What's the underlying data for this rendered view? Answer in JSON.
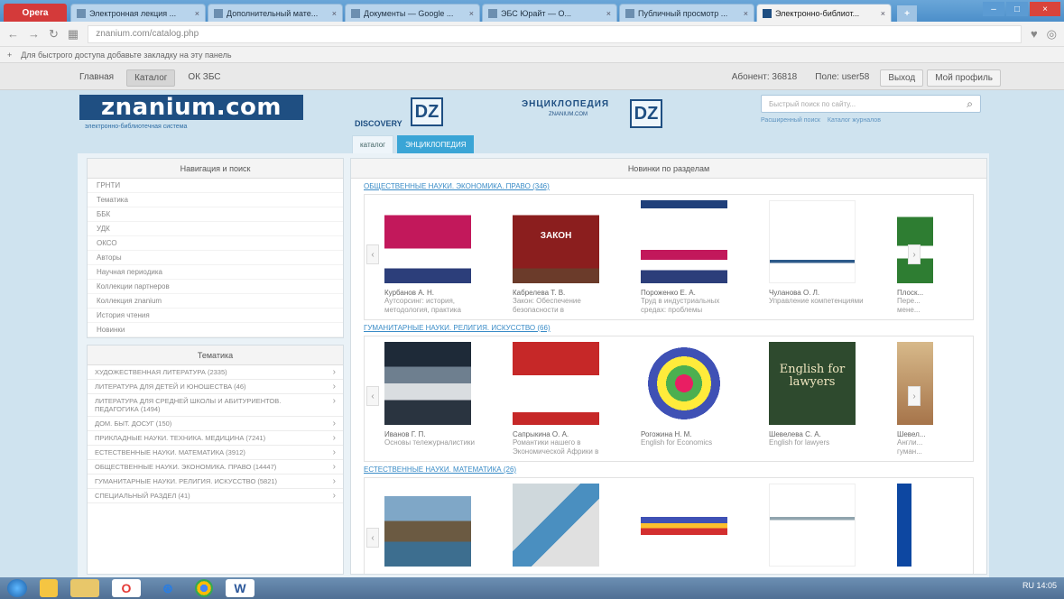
{
  "browser": {
    "opera_label": "Opera",
    "tabs": [
      {
        "title": "Электронная лекция ..."
      },
      {
        "title": "Дополнительный мате..."
      },
      {
        "title": "Документы — Google ..."
      },
      {
        "title": "ЭБС Юрайт — О..."
      },
      {
        "title": "Публичный просмотр ..."
      },
      {
        "title": "Электронно-библиот..."
      }
    ],
    "new_tab": "+",
    "url": "znanium.com/catalog.php",
    "bookmark_hint": "Для быстрого доступа добавьте закладку на эту панель"
  },
  "site_nav": {
    "left": [
      "Главная",
      "Каталог",
      "ОК ЗБС"
    ],
    "right": [
      "Абонент: 36818",
      "Поле: user58",
      "Выход",
      "Мой профиль"
    ]
  },
  "header": {
    "logo": "znanium.com",
    "logo_sub": "электронно-библиотечная система",
    "discovery_label": "DISCOVERY",
    "dz_mark": "DZ",
    "enc_label": "ЭНЦИКЛОПЕДИЯ",
    "enc_sub": "ZNANIUM.COM",
    "search_placeholder": "Быстрый поиск по сайту...",
    "search_links": [
      "Расширенный поиск",
      "Каталог журналов"
    ],
    "tabs": [
      "каталог",
      "ЭНЦИКЛОПЕДИЯ"
    ]
  },
  "nav_panel": {
    "title": "Навигация и поиск",
    "items": [
      "ГРНТИ",
      "Тематика",
      "ББК",
      "УДК",
      "ОКСО",
      "Авторы",
      "Научная периодика",
      "Коллекции партнеров",
      "Коллекция znanium",
      "История чтения",
      "Новинки"
    ]
  },
  "theme_panel": {
    "title": "Тематика",
    "items": [
      "Художественная литература (2335)",
      "Литература для детей и юношества (46)",
      "Литература для средней школы и абитуриентов. Педагогика (1494)",
      "Дом. Быт. Досуг (150)",
      "Прикладные науки. Техника. Медицина (7241)",
      "Естественные науки. Математика (3912)",
      "Общественные науки. Экономика. Право (14447)",
      "Гуманитарные науки. Религия. Искусство (5821)",
      "Специальный раздел (41)"
    ]
  },
  "content": {
    "title": "Новинки по разделам",
    "sections": [
      {
        "title": "Общественные науки. Экономика. Право (346)",
        "books": [
          {
            "author": "Курбанов А. Н.",
            "title": "Аутсорсинг: история, методология, практика"
          },
          {
            "author": "Кабрелева Т. В.",
            "title": "Закон: Обеспечение безопасности в"
          },
          {
            "author": "Пороженко Е. А.",
            "title": "Труд в индустриальных средах: проблемы"
          },
          {
            "author": "Чуланова О. Л.",
            "title": "Управление компетенциями"
          },
          {
            "author": "Плоск...",
            "title": "Пере... мене..."
          }
        ]
      },
      {
        "title": "Гуманитарные науки. Религия. Искусство (66)",
        "books": [
          {
            "author": "Иванов Г. П.",
            "title": "Основы тележурналистики"
          },
          {
            "author": "Сапрыкина О. А.",
            "title": "Романтики нашего в Экономической Африки в"
          },
          {
            "author": "Рогожина Н. М.",
            "title": "English for Economics"
          },
          {
            "author": "Шевелева С. А.",
            "title": "English for lawyers"
          },
          {
            "author": "Шевел...",
            "title": "Англи... гуман..."
          }
        ]
      },
      {
        "title": "Естественные науки. Математика (26)",
        "books": [
          {
            "author": "",
            "title": ""
          },
          {
            "author": "",
            "title": ""
          },
          {
            "author": "",
            "title": ""
          },
          {
            "author": "",
            "title": ""
          },
          {
            "author": "",
            "title": ""
          }
        ]
      }
    ],
    "english_cover_text": "English for lawyers",
    "law_cover_text": "ЗАКОН"
  },
  "taskbar": {
    "tray_text": "RU  14:05"
  }
}
